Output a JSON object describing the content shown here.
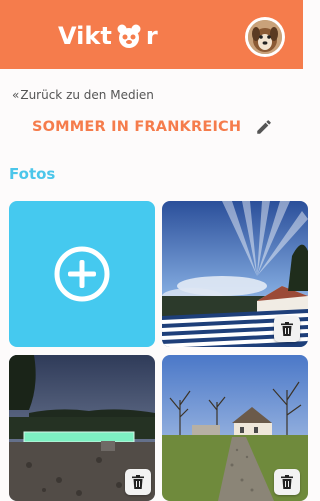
{
  "header": {
    "logo_prefix": "Vikt",
    "logo_suffix": "r",
    "logo_icon": "paw-icon",
    "avatar_icon": "dog-avatar",
    "bg_color": "#f57c4c"
  },
  "nav": {
    "back_chevron": "«",
    "back_label": "Zurück zu den Medien"
  },
  "album": {
    "title": "SOMMER IN FRANKREICH",
    "edit_icon": "pencil-icon"
  },
  "section": {
    "label": "Fotos",
    "color": "#4cc6ea"
  },
  "grid": {
    "add_icon": "plus-circle-icon",
    "add_color": "#45c9ef",
    "photos": [
      {
        "scene": "sky with sun rays, striped deck chair",
        "delete_icon": "trash-icon"
      },
      {
        "scene": "pool at dusk with trees",
        "delete_icon": "trash-icon"
      },
      {
        "scene": "gravel road to farmhouse",
        "delete_icon": "trash-icon"
      }
    ]
  }
}
